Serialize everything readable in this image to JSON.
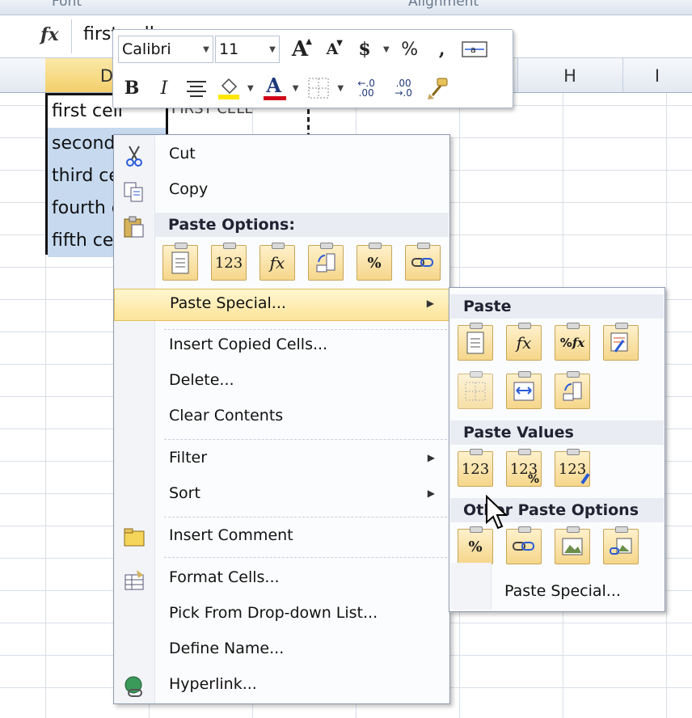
{
  "ribbon": {
    "group_font": "Font",
    "group_alignment": "Alignment"
  },
  "formula_bar": {
    "fx_icon": "fx",
    "value": "first cell"
  },
  "columns": [
    "",
    "D",
    "",
    "",
    "",
    "",
    "H",
    "I"
  ],
  "cells": [
    "first cell",
    "second cell",
    "third cell",
    "fourth cell",
    "fifth cell"
  ],
  "copied_cell_text": "FIRST CELL",
  "mini_toolbar": {
    "font_name": "Calibri",
    "font_size": "11",
    "grow_font": "A",
    "shrink_font": "A",
    "currency": "$",
    "percent": "%",
    "comma": ",",
    "bold": "B",
    "italic": "I",
    "font_color": "A",
    "increase_decimal": "←.0 .00",
    "decrease_decimal": ".00 →.0",
    "icons": [
      "merge-center-icon",
      "align-center-icon",
      "fill-color-icon",
      "borders-icon",
      "format-painter-icon"
    ]
  },
  "context_menu": {
    "cut": "Cut",
    "copy": "Copy",
    "paste_options_header": "Paste Options:",
    "paste_options": [
      "paste-icon",
      "values-123-icon",
      "formulas-fx-icon",
      "transpose-icon",
      "formatting-icon",
      "paste-link-icon"
    ],
    "paste_special": "Paste Special...",
    "insert_copied_cells": "Insert Copied Cells...",
    "delete": "Delete...",
    "clear_contents": "Clear Contents",
    "filter": "Filter",
    "sort": "Sort",
    "insert_comment": "Insert Comment",
    "format_cells": "Format Cells...",
    "pick_from_list": "Pick From Drop-down List...",
    "define_name": "Define Name...",
    "hyperlink": "Hyperlink..."
  },
  "submenu": {
    "paste_header": "Paste",
    "paste_values_header": "Paste Values",
    "other_header": "Other Paste Options",
    "paste_special": "Paste Special...",
    "labels_123": "123",
    "labels_pct": "%",
    "labels_fx": "fx"
  },
  "colors": {
    "selection": "#c6d9ef",
    "highlight": "#fde49a",
    "paste_button": "#f5d68a",
    "font_red": "#d0021b",
    "fill_yellow": "#ffe600"
  }
}
